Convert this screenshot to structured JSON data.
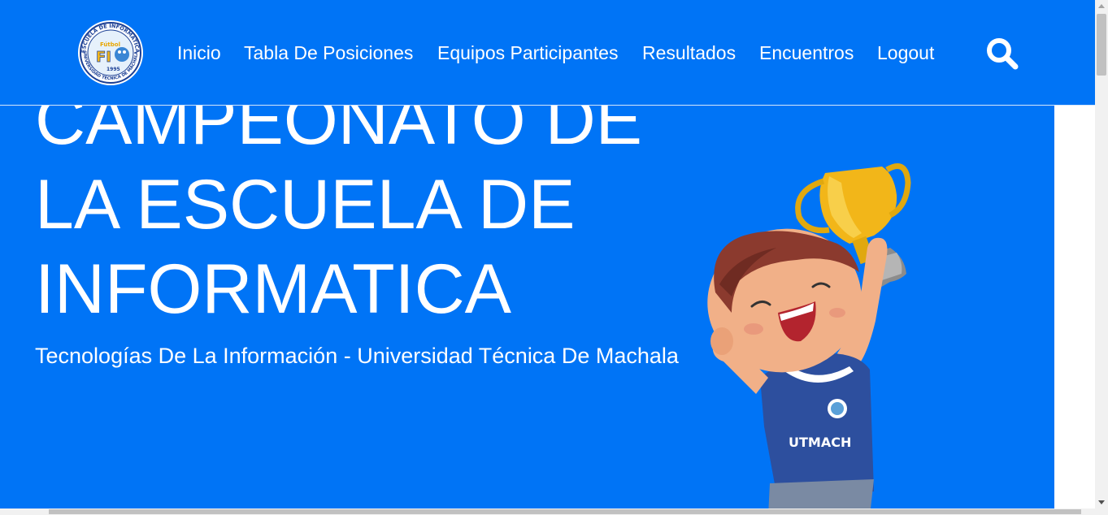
{
  "navbar": {
    "logo": {
      "top_arc_text": "ESCUELA DE INFORMATICA",
      "bottom_arc_text": "UNIVERSIDAD TÉCNICA DE MACHALA",
      "center_text": "FI",
      "year": "1995",
      "sport_text": "Fútbol"
    },
    "links": [
      {
        "label": "Inicio"
      },
      {
        "label": "Tabla De Posiciones"
      },
      {
        "label": "Equipos Participantes"
      },
      {
        "label": "Resultados"
      },
      {
        "label": "Encuentros"
      },
      {
        "label": "Logout"
      }
    ],
    "search_icon": "search-icon"
  },
  "hero": {
    "title_lines": [
      "CAMPEONATO DE",
      "LA ESCUELA DE",
      "INFORMATICA"
    ],
    "subtitle": "Tecnologías De La Información - Universidad Técnica De Machala",
    "mascot_shirt_text": "UTMACH"
  },
  "colors": {
    "primary": "#0074f6",
    "text": "#ffffff",
    "shirt": "#2d4f9e",
    "trophy": "#f2b619"
  }
}
